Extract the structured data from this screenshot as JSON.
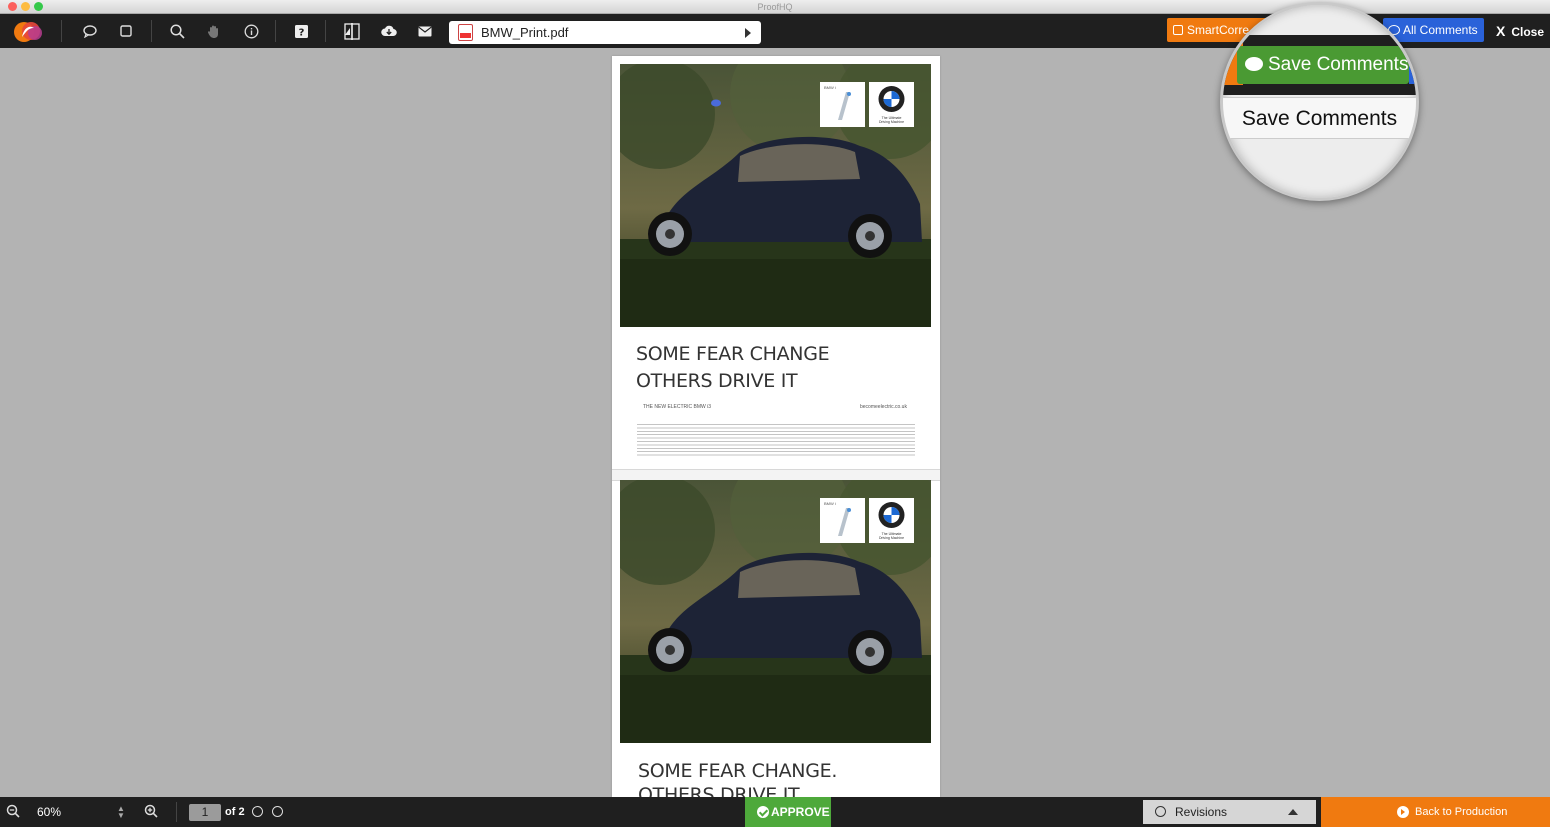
{
  "window": {
    "title": "ProofHQ"
  },
  "colors": {
    "orange": "#f07a10",
    "blue": "#2a62d9",
    "green": "#4ea93b",
    "toolbar": "#1f1f1f"
  },
  "toolbar": {
    "tools": [
      "comment-icon",
      "rectangle-icon",
      "search-icon",
      "pan-hand-icon",
      "info-icon",
      "help-icon",
      "compare-icon",
      "download-icon",
      "email-icon"
    ],
    "file_name": "BMW_Print.pdf",
    "smart_compare_label": "SmartCompare",
    "smart_compare_visible": "SmartCorre",
    "all_comments_label": "All Comments",
    "close_x": "X",
    "close_label": "Close"
  },
  "magnifier": {
    "save_button_label": "Save Comments",
    "menu_item_label": "Save Comments"
  },
  "document": {
    "pages": [
      {
        "headline_line1": "SOME FEAR CHANGE",
        "headline_line2": "OTHERS DRIVE IT",
        "tagline": "THE NEW ELECTRIC BMW i3",
        "url": "becomeelectric.co.uk",
        "brand_badge_text": "BMW i",
        "slogan": "The Ultimate Driving Machine"
      },
      {
        "headline_line1": "SOME FEAR CHANGE.",
        "headline_line2": "OTHERS DRIVE IT",
        "brand_badge_text": "BMW i",
        "slogan": "The Ultimate Driving Machine"
      }
    ]
  },
  "bottombar": {
    "zoom": "60%",
    "current_page": "1",
    "page_total": "of 2",
    "approve_label": "APPROVE",
    "revisions_label": "Revisions",
    "back_label": "Back to Production"
  }
}
